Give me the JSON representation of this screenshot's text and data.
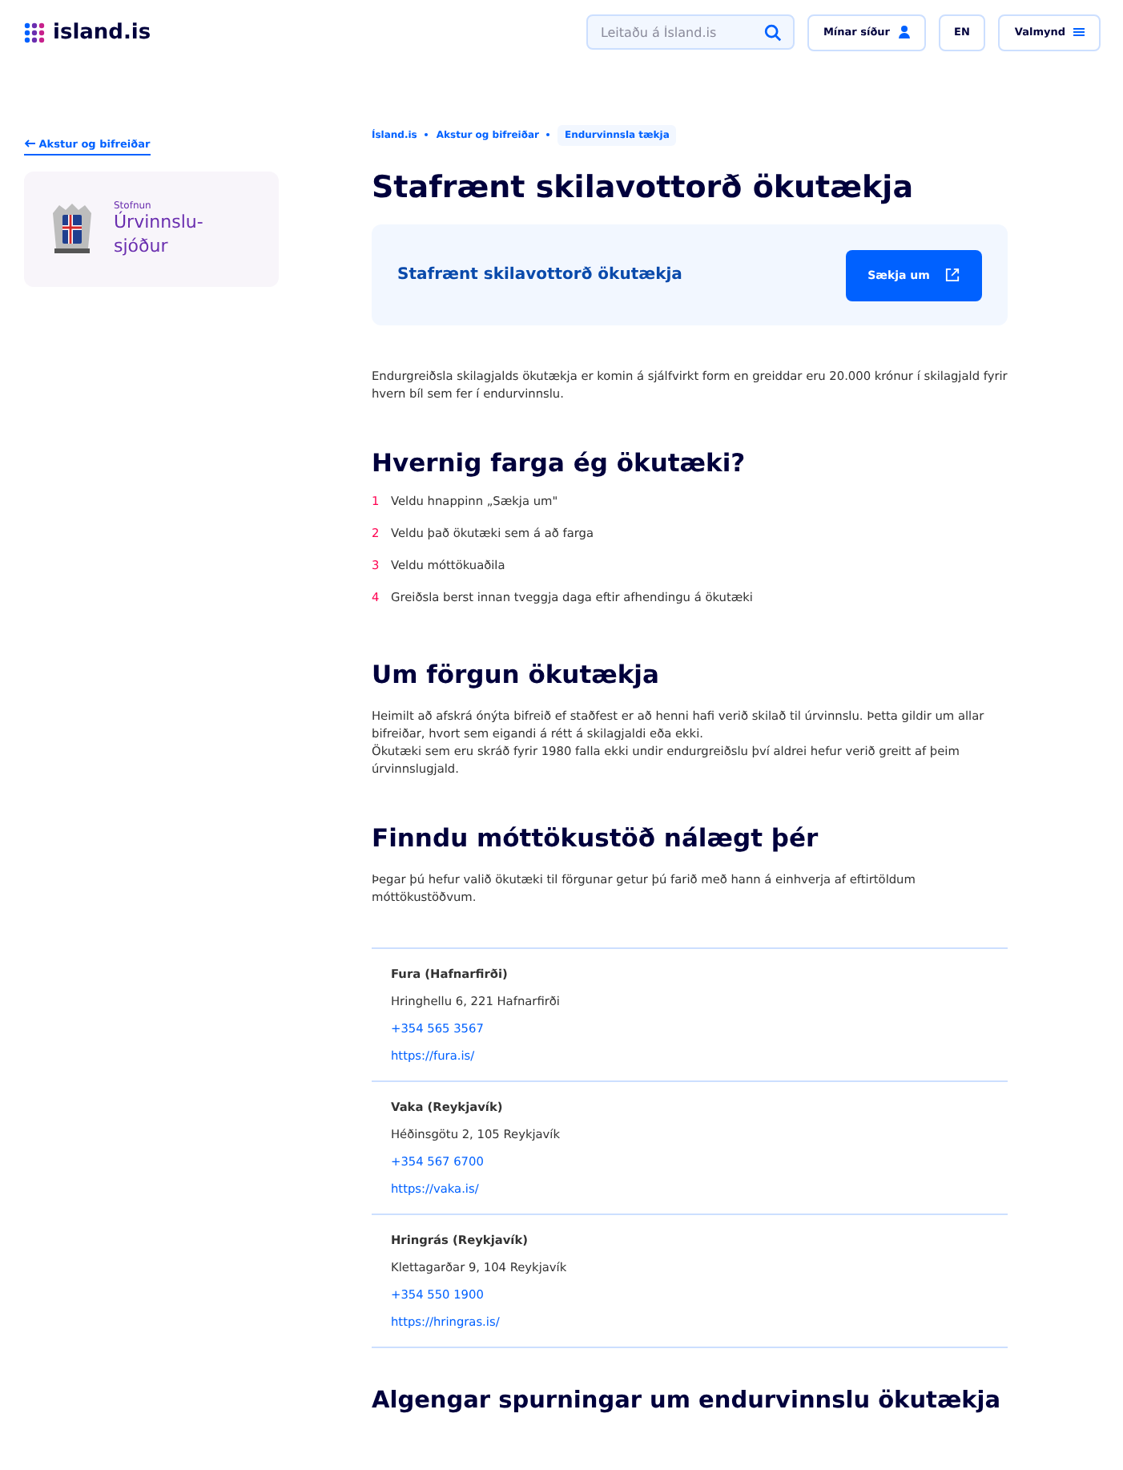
{
  "header": {
    "logo": "island.is",
    "search": {
      "placeholder": "Leitaðu á Ísland.is"
    },
    "buttons": [
      {
        "label": "Mínar síður",
        "kind": "user"
      },
      {
        "label": "EN",
        "kind": "plain"
      },
      {
        "label": "Valmynd",
        "kind": "menu"
      }
    ]
  },
  "sidebar": {
    "back_link": "Akstur og bifreiðar",
    "org": {
      "label": "Stofnun",
      "name": "Úrvinnslu-sjóður"
    }
  },
  "breadcrumbs": [
    {
      "label": "Ísland.is",
      "selected": false
    },
    {
      "label": "Akstur og bifreiðar",
      "selected": false
    },
    {
      "label": "Endurvinnsla tækja",
      "selected": true
    }
  ],
  "title": "Stafrænt skilavottorð ökutækja",
  "action_card": {
    "title": "Stafrænt skilavottorð ökutækja",
    "button": "Sækja um"
  },
  "intro": "Endurgreiðsla skilagjalds ökutækja er komin á sjálfvirkt form en greiddar eru 20.000 krónur í skilagjald fyrir hvern bíl sem fer í endurvinnslu.",
  "sections": [
    {
      "heading": "Hvernig farga ég ökutæki?",
      "steps": [
        {
          "number": "1",
          "text": "Veldu hnappinn „Sækja um\""
        },
        {
          "number": "2",
          "text": "Veldu það ökutæki sem á að farga"
        },
        {
          "number": "3",
          "text": "Veldu móttökuaðila"
        },
        {
          "number": "4",
          "text": "Greiðsla berst innan tveggja daga eftir afhendingu á ökutæki"
        }
      ]
    },
    {
      "heading": "Um förgun ökutækja",
      "paragraphs": [
        "Heimilt að afskrá ónýta bifreið ef staðfest er að henni hafi verið skilað til úrvinnslu. Þetta gildir um allar bifreiðar, hvort sem eigandi á rétt á skilagjaldi eða ekki.",
        "Ökutæki sem eru skráð fyrir 1980 falla ekki undir endurgreiðslu því aldrei hefur verið greitt af þeim úrvinnslugjald."
      ]
    },
    {
      "heading": "Finndu móttökustöð nálægt þér",
      "paragraphs": [
        "Þegar þú hefur valið ökutæki til förgunar getur þú farið með hann á einhverja af eftirtöldum móttökustöðvum."
      ]
    }
  ],
  "stations": [
    {
      "name": "Fura (Hafnarfirði)",
      "address": "Hringhellu 6, 221 Hafnarfirði",
      "phone": "+354 565 3567",
      "url": "https://fura.is/"
    },
    {
      "name": "Vaka (Reykjavík)",
      "address": "Héðinsgötu 2, 105 Reykjavík",
      "phone": "+354 567 6700",
      "url": "https://vaka.is/"
    },
    {
      "name": "Hringrás (Reykjavík)",
      "address": "Klettagarðar 9, 104 Reykjavík",
      "phone": "+354 550 1900",
      "url": "https://hringras.is/"
    }
  ],
  "faq_heading": "Algengar spurningar um endurvinnslu ökutækja"
}
